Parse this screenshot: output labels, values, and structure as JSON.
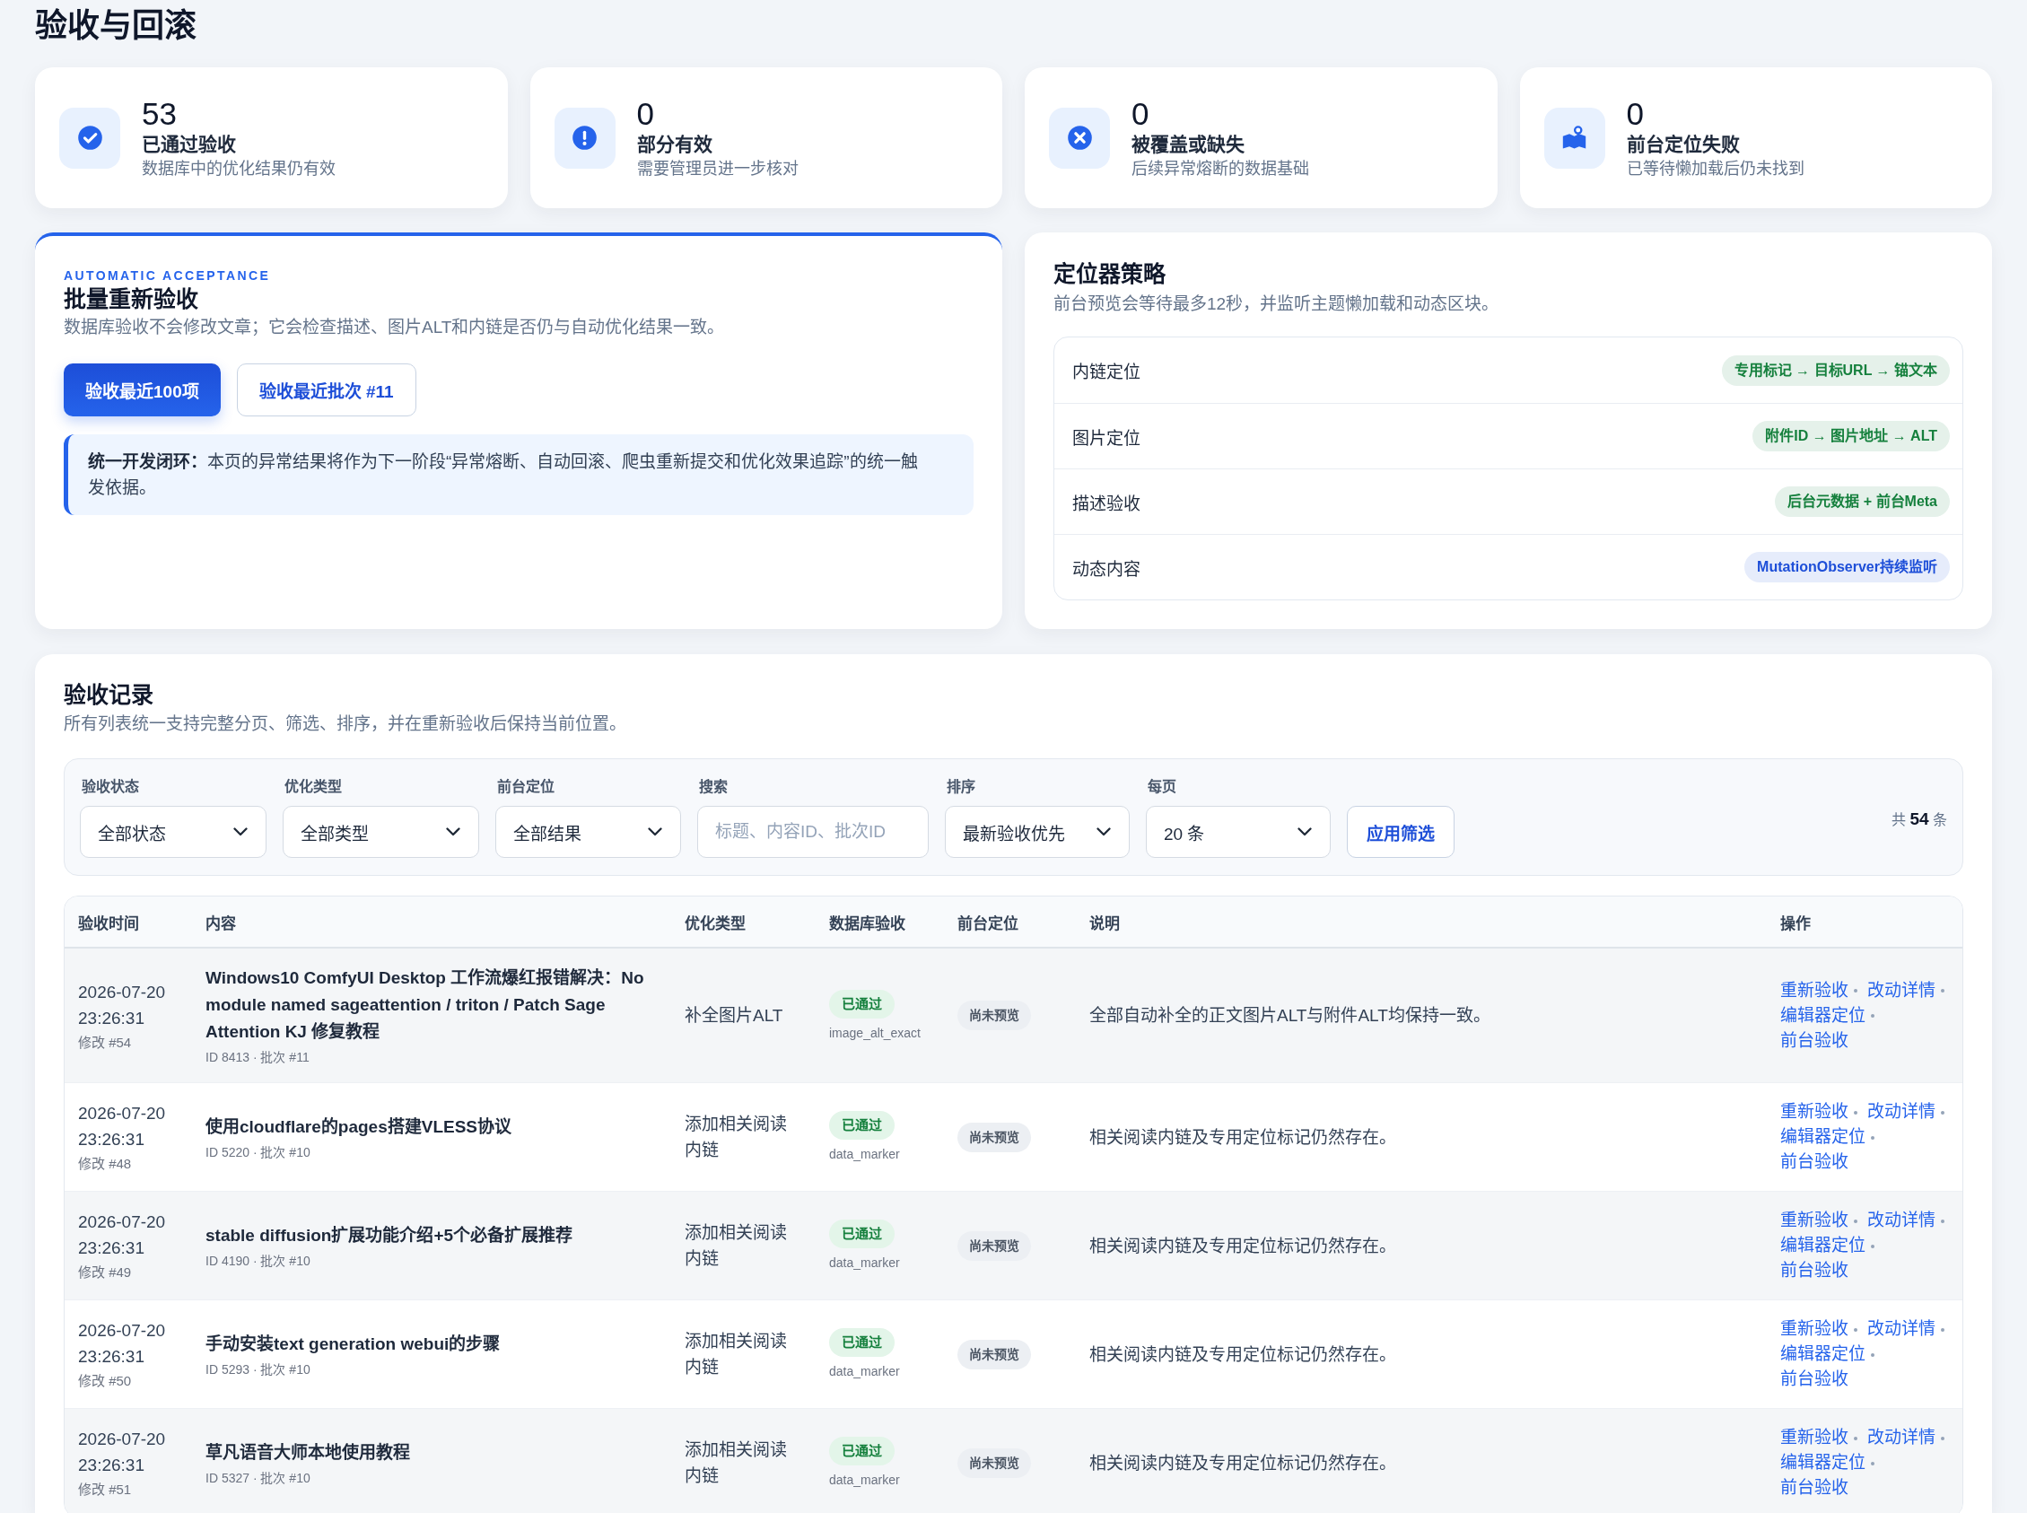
{
  "page": {
    "title": "验收与回滚"
  },
  "stats": [
    {
      "kind": "passed",
      "value": "53",
      "label": "已通过验收",
      "note": "数据库中的优化结果仍有效"
    },
    {
      "kind": "partial",
      "value": "0",
      "label": "部分有效",
      "note": "需要管理员进一步核对"
    },
    {
      "kind": "missing",
      "value": "0",
      "label": "被覆盖或缺失",
      "note": "后续异常熔断的数据基础"
    },
    {
      "kind": "locate_failed",
      "value": "0",
      "label": "前台定位失败",
      "note": "已等待懒加载后仍未找到"
    }
  ],
  "batch_panel": {
    "eyebrow": "AUTOMATIC ACCEPTANCE",
    "title": "批量重新验收",
    "description": "数据库验收不会修改文章；它会检查描述、图片ALT和内链是否仍与自动优化结果一致。",
    "buttons": [
      {
        "kind": "primary",
        "label": "验收最近100项"
      },
      {
        "kind": "secondary",
        "label": "验收最近批次 #11"
      }
    ],
    "callout": "**统一开发闭环：**本页的异常结果将作为下一阶段“异常熔断、自动回滚、爬虫重新提交和优化效果追踪”的统一触发依据。"
  },
  "locator_panel": {
    "title": "定位器策略",
    "description": "前台预览会等待最多12秒，并监听主题懒加载和动态区块。",
    "rows": [
      {
        "label": "内链定位",
        "tag": "专用标记 → 目标URL → 锚文本",
        "color": "#15803d"
      },
      {
        "label": "图片定位",
        "tag": "附件ID → 图片地址 → ALT",
        "color": "#15803d"
      },
      {
        "label": "描述验收",
        "tag": "后台元数据 + 前台Meta",
        "color": "#15803d"
      },
      {
        "label": "动态内容",
        "tag": "MutationObserver持续监听",
        "color": "#1d4ed8"
      }
    ]
  },
  "records": {
    "title": "验收记录",
    "description": "所有列表统一支持完整分页、筛选、排序，并在重新验收后保持当前位置。",
    "filters": [
      {
        "kind": "select",
        "label": "验收状态",
        "value": "全部状态"
      },
      {
        "kind": "select",
        "label": "优化类型",
        "value": "全部类型"
      },
      {
        "kind": "select",
        "label": "前台定位",
        "value": "全部结果"
      },
      {
        "kind": "search",
        "label": "搜索",
        "placeholder": "标题、内容ID、批次ID"
      },
      {
        "kind": "select",
        "label": "排序",
        "value": "最新验收优先"
      },
      {
        "kind": "select",
        "label": "每页",
        "value": "20 条"
      }
    ],
    "apply_button": "应用筛选",
    "total": "共 **54** 条",
    "table": {
      "columns": [
        "验收时间",
        "内容",
        "优化类型",
        "数据库验收",
        "前台定位",
        "说明",
        "操作"
      ],
      "rows": [
        {
          "time": "2026-07-20 23:26:31",
          "revision": "修改 #54",
          "title": "Windows10 ComfyUI Desktop 工作流爆红报错解决：No module named sageattention / triton / Patch Sage Attention KJ 修复教程",
          "meta": "ID 8413 · 批次 #11",
          "type": "补全图片ALT",
          "db_status": "已通过",
          "db_rule": "image_alt_exact",
          "frontend_status": "尚未预览",
          "note": "全部自动补全的正文图片ALT与附件ALT均保持一致。",
          "actions": [
            "重新验收",
            "改动详情",
            "编辑器定位",
            "前台验收"
          ]
        },
        {
          "time": "2026-07-20 23:26:31",
          "revision": "修改 #48",
          "title": "使用cloudflare的pages搭建VLESS协议",
          "meta": "ID 5220 · 批次 #10",
          "type": "添加相关阅读内链",
          "db_status": "已通过",
          "db_rule": "data_marker",
          "frontend_status": "尚未预览",
          "note": "相关阅读内链及专用定位标记仍然存在。",
          "actions": [
            "重新验收",
            "改动详情",
            "编辑器定位",
            "前台验收"
          ]
        },
        {
          "time": "2026-07-20 23:26:31",
          "revision": "修改 #49",
          "title": "stable diffusion扩展功能介绍+5个必备扩展推荐",
          "meta": "ID 4190 · 批次 #10",
          "type": "添加相关阅读内链",
          "db_status": "已通过",
          "db_rule": "data_marker",
          "frontend_status": "尚未预览",
          "note": "相关阅读内链及专用定位标记仍然存在。",
          "actions": [
            "重新验收",
            "改动详情",
            "编辑器定位",
            "前台验收"
          ]
        },
        {
          "time": "2026-07-20 23:26:31",
          "revision": "修改 #50",
          "title": "手动安装text generation webui的步骤",
          "meta": "ID 5293 · 批次 #10",
          "type": "添加相关阅读内链",
          "db_status": "已通过",
          "db_rule": "data_marker",
          "frontend_status": "尚未预览",
          "note": "相关阅读内链及专用定位标记仍然存在。",
          "actions": [
            "重新验收",
            "改动详情",
            "编辑器定位",
            "前台验收"
          ]
        },
        {
          "time": "2026-07-20 23:26:31",
          "revision": "修改 #51",
          "title": "草凡语音大师本地使用教程",
          "meta": "ID 5327 · 批次 #10",
          "type": "添加相关阅读内链",
          "db_status": "已通过",
          "db_rule": "data_marker",
          "frontend_status": "尚未预览",
          "note": "相关阅读内链及专用定位标记仍然存在。",
          "actions": [
            "重新验收",
            "改动详情",
            "编辑器定位",
            "前台验收"
          ]
        }
      ]
    }
  }
}
